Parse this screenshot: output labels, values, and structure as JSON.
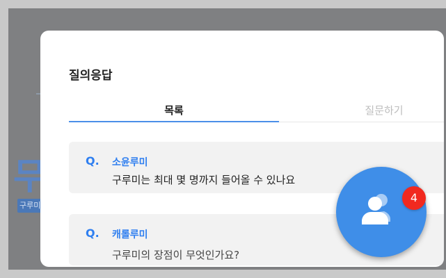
{
  "background": {
    "heading_fragment": "무",
    "badge_fragment": "구루미"
  },
  "modal": {
    "title": "질의응답",
    "tabs": [
      {
        "label": "목록",
        "active": true
      },
      {
        "label": "질문하기",
        "active": false
      }
    ],
    "questions": [
      {
        "marker": "Q.",
        "author": "소윤루미",
        "text": "구루미는 최대 몇 명까지 들어올 수 있나요"
      },
      {
        "marker": "Q.",
        "author": "캐롤루미",
        "text": "구루미의 장점이 무엇인가요?"
      }
    ]
  },
  "fab": {
    "icon": "user-icon",
    "badge_count": "4"
  },
  "colors": {
    "accent": "#2f7ff0",
    "fab": "#3f8ee8",
    "badge": "#f1291f",
    "overlay": "#7f8082"
  }
}
